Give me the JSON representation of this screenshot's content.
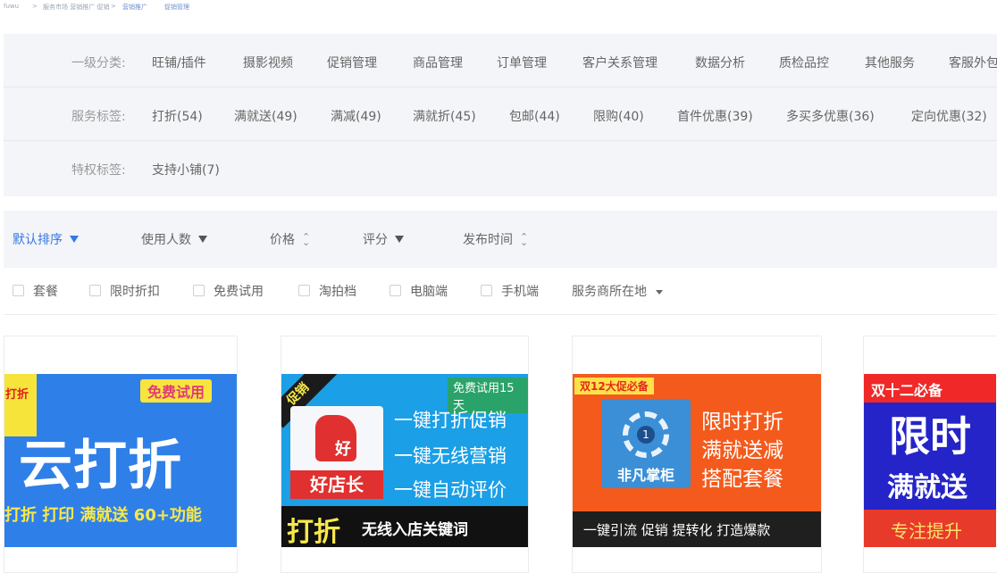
{
  "breadcrumb": {
    "items": [
      "fuwu",
      "服务市场 营销推广 促销",
      "营销推广",
      "促销管理"
    ],
    "separators": [
      ">",
      ">"
    ]
  },
  "filters": {
    "category": {
      "label": "一级分类:",
      "items": [
        "旺铺/插件",
        "摄影视频",
        "促销管理",
        "商品管理",
        "订单管理",
        "客户关系管理",
        "数据分析",
        "质检品控",
        "其他服务",
        "客服外包"
      ]
    },
    "service_tags": {
      "label": "服务标签:",
      "items": [
        "打折(54)",
        "满就送(49)",
        "满减(49)",
        "满就折(45)",
        "包邮(44)",
        "限购(40)",
        "首件优惠(39)",
        "多买多优惠(36)",
        "定向优惠(32)"
      ]
    },
    "privilege_tags": {
      "label": "特权标签:",
      "items": [
        "支持小铺(7)"
      ]
    }
  },
  "sort": {
    "items": [
      {
        "label": "默认排序",
        "indicator": "arrow-down",
        "active": true
      },
      {
        "label": "使用人数",
        "indicator": "arrow-down",
        "active": false
      },
      {
        "label": "价格",
        "indicator": "up-down",
        "active": false
      },
      {
        "label": "评分",
        "indicator": "arrow-down",
        "active": false
      },
      {
        "label": "发布时间",
        "indicator": "up-down",
        "active": false
      }
    ]
  },
  "checkboxes": {
    "items": [
      "套餐",
      "限时折扣",
      "免费试用",
      "淘拍档",
      "电脑端",
      "手机端"
    ],
    "dropdown_label": "服务商所在地"
  },
  "cards": [
    {
      "corner": "打折",
      "trial": "免费试用",
      "title": "云打折",
      "subtitle": "打折 打印 满就送 60+功能"
    },
    {
      "corner": "促销",
      "trial": "免费试用15天",
      "logo_word": "好",
      "logo_name": "好店长",
      "features": [
        "一键打折促销",
        "一键无线营销",
        "一键自动评价"
      ],
      "bottom_big": "打折",
      "bottom_text": "无线入店关键词"
    },
    {
      "tag": "双12大促必备",
      "logo_digit": "1",
      "logo_name": "非凡掌柜",
      "features": [
        "限时打折",
        "满就送减",
        "搭配套餐"
      ],
      "bottom_text": "一键引流 促销 提转化 打造爆款"
    },
    {
      "header": "双十二必备",
      "title": "限时",
      "subtitle": "满就送",
      "bottom_text": "专注提升"
    }
  ],
  "colors": {
    "accent": "#3478e5",
    "panel_bg": "#f4f5f8"
  }
}
